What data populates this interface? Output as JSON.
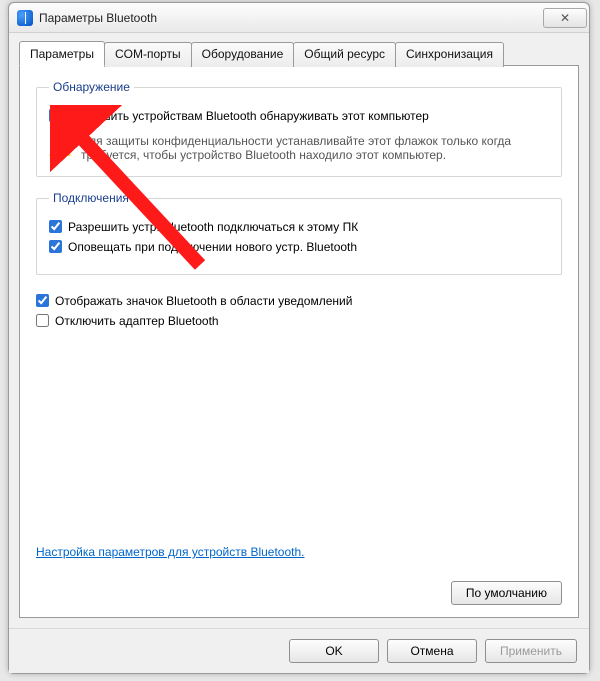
{
  "window": {
    "title": "Параметры Bluetooth",
    "close_glyph": "✕"
  },
  "tabs": {
    "selected_index": 0,
    "items": [
      "Параметры",
      "COM-порты",
      "Оборудование",
      "Общий ресурс",
      "Синхронизация"
    ]
  },
  "discovery": {
    "legend": "Обнаружение",
    "allow_label": "Разрешить устройствам Bluetooth обнаруживать этот компьютер",
    "allow_checked": true,
    "warning_text": "Для защиты конфиденциальности устанавливайте этот флажок только когда требуется, чтобы устройство Bluetooth находило этот компьютер."
  },
  "connections": {
    "legend": "Подключения",
    "allow_connect_label": "Разрешить устр. Bluetooth подключаться к этому ПК",
    "allow_connect_checked": true,
    "notify_label": "Оповещать при подключении нового устр. Bluetooth",
    "notify_checked": true
  },
  "misc": {
    "tray_icon_label": "Отображать значок Bluetooth в области уведомлений",
    "tray_icon_checked": true,
    "disable_adapter_label": "Отключить адаптер Bluetooth",
    "disable_adapter_checked": false
  },
  "link_text": "Настройка параметров для устройств Bluetooth.",
  "buttons": {
    "defaults": "По умолчанию",
    "ok": "OK",
    "cancel": "Отмена",
    "apply": "Применить"
  }
}
